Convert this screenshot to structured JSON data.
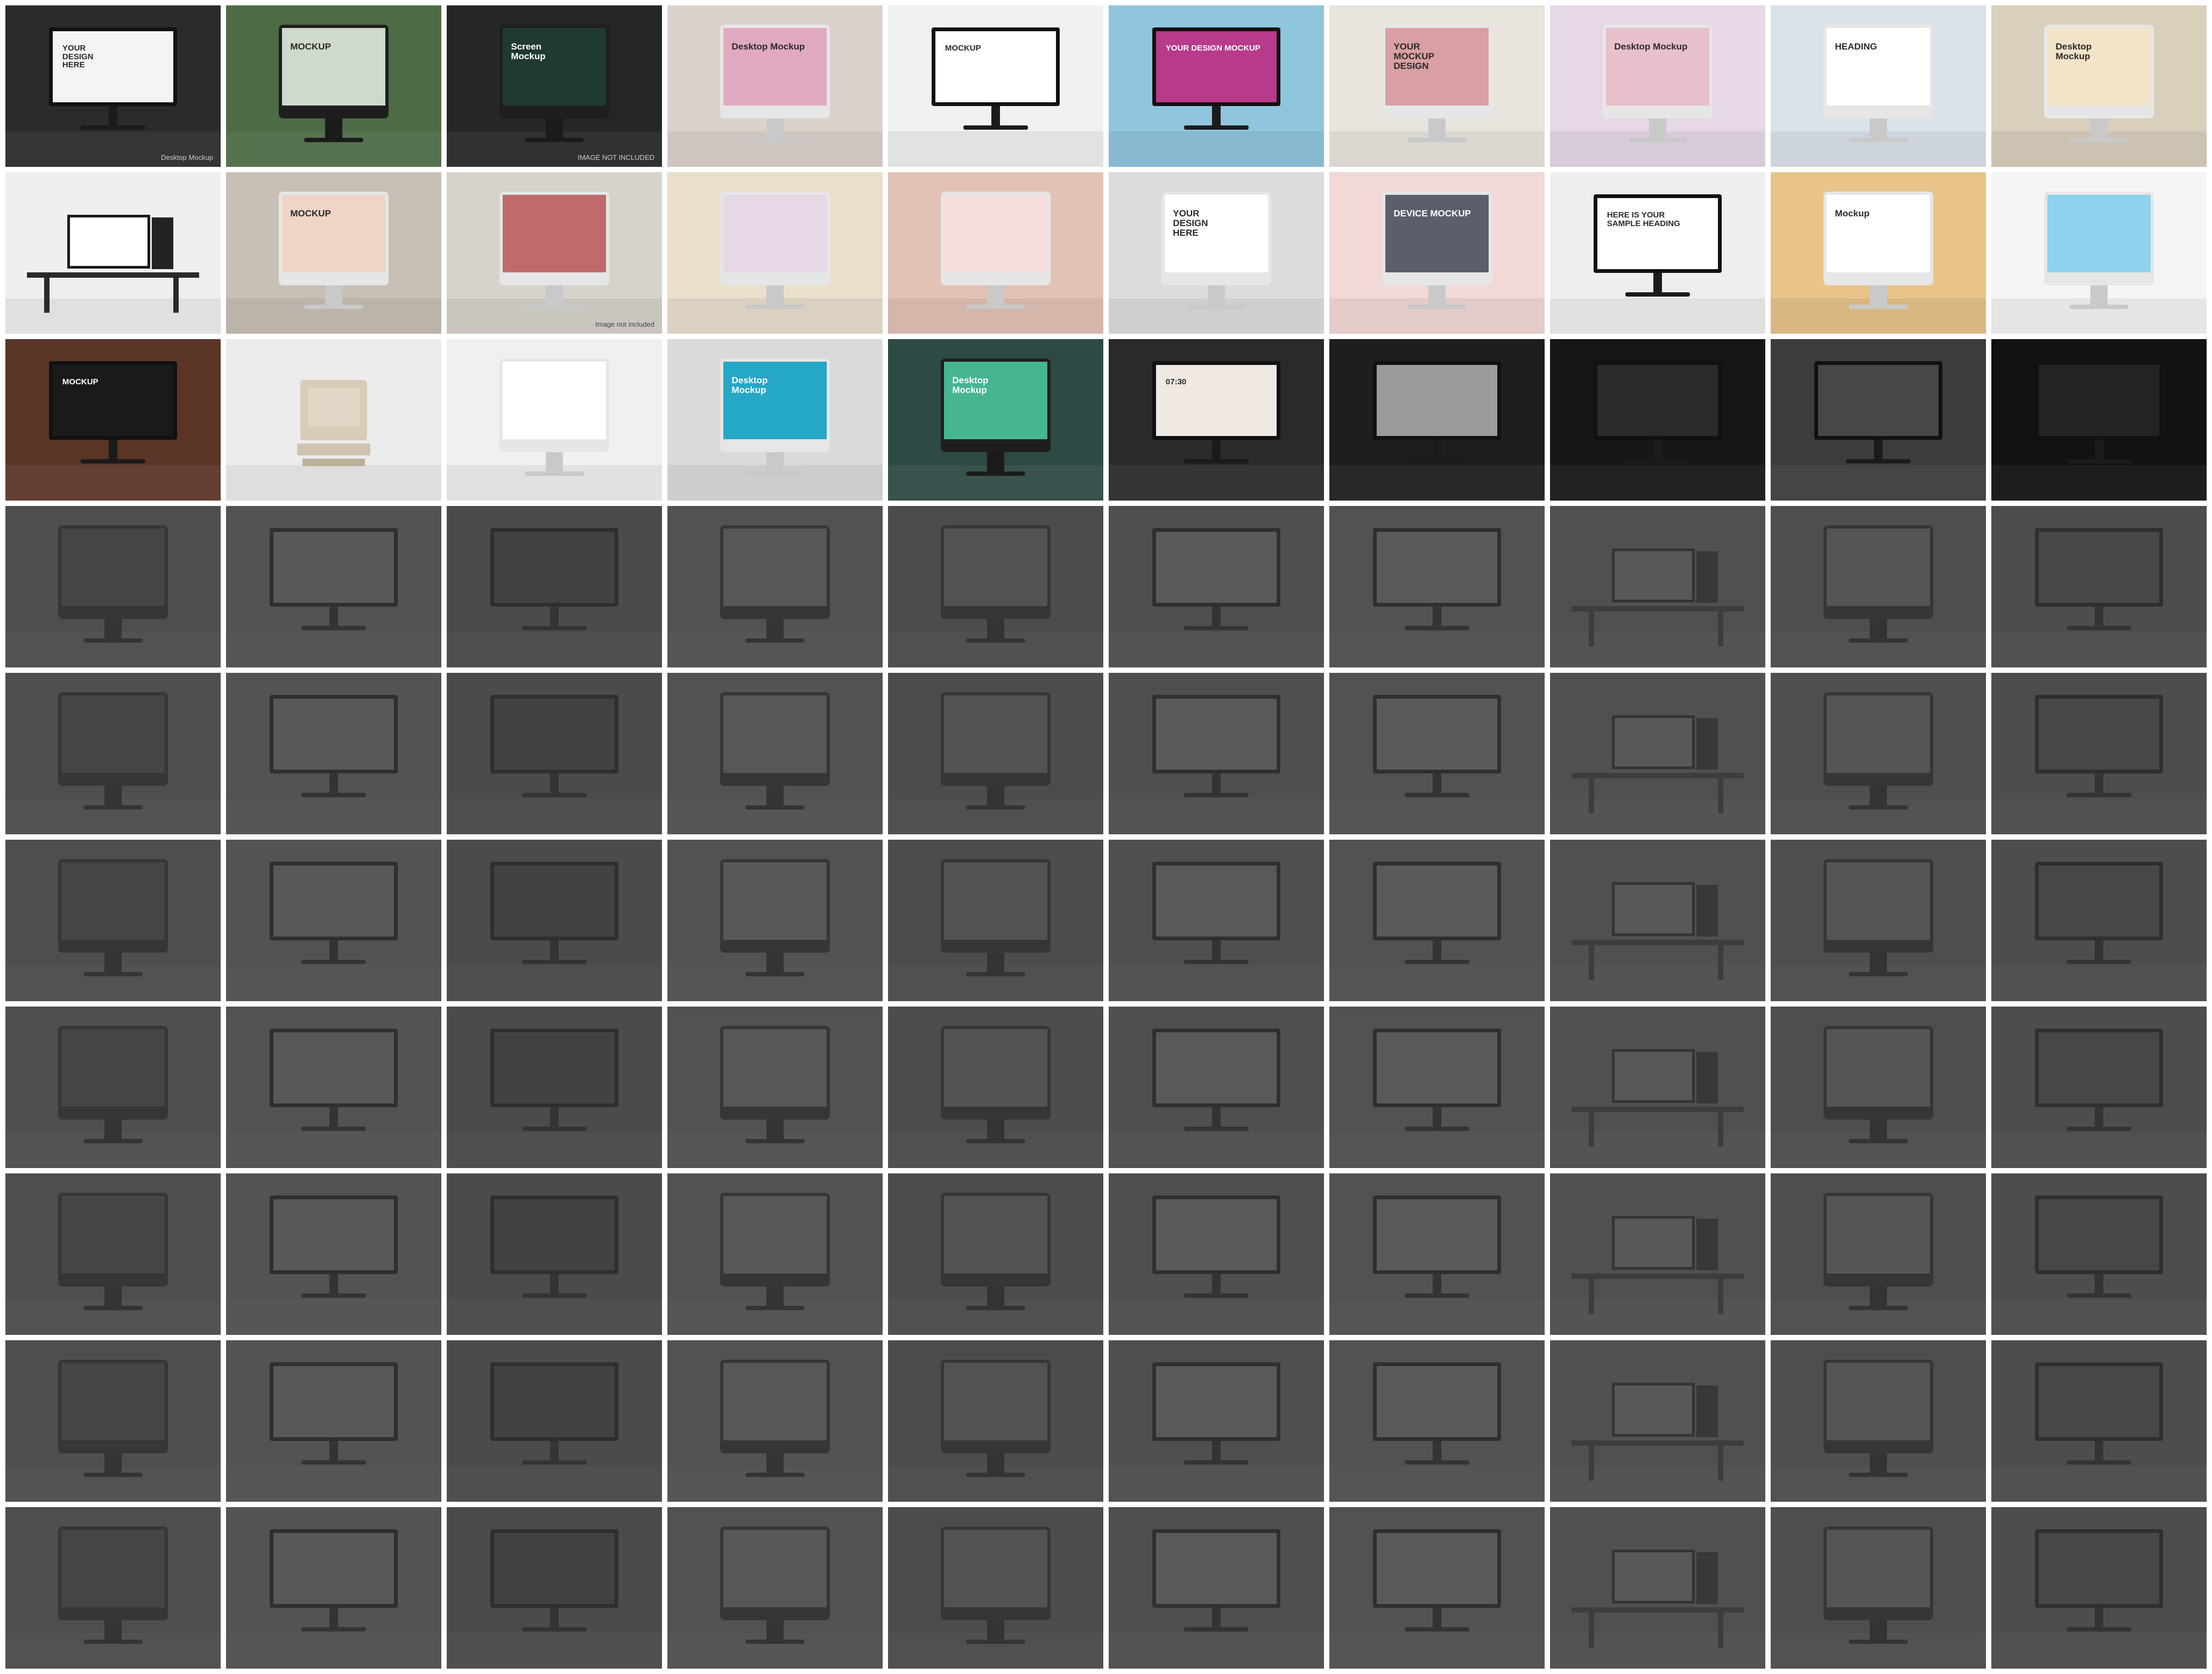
{
  "grid": {
    "cols": 10,
    "rows": 10,
    "tiles": [
      {
        "bg": "#2b2b2b",
        "screen": "#f4f4f4",
        "kind": "monitor",
        "text": "YOUR\nDESIGN\nHERE",
        "sub": "Desktop Mockup",
        "tone": "dark"
      },
      {
        "bg": "#4d6b45",
        "screen": "#cfd9cc",
        "kind": "imac",
        "text": "MOCKUP",
        "sub": "",
        "tone": "green"
      },
      {
        "bg": "#262626",
        "screen": "#1f3a2e",
        "kind": "imac",
        "text": "Screen\nMockup",
        "sub": "IMAGE NOT INCLUDED",
        "tone": "dark"
      },
      {
        "bg": "#dcd2cc",
        "screen": "#e1a9c0",
        "kind": "imac",
        "text": "Desktop Mockup",
        "sub": "",
        "tone": "light"
      },
      {
        "bg": "#f1f1f1",
        "screen": "#ffffff",
        "kind": "monitor",
        "text": "MOCKUP",
        "sub": "",
        "tone": "light"
      },
      {
        "bg": "#8fc5dd",
        "screen": "#b83a8a",
        "kind": "monitor",
        "text": "YOUR DESIGN MOCKUP",
        "sub": "",
        "tone": "blue"
      },
      {
        "bg": "#e9e4de",
        "screen": "#d9a0a4",
        "kind": "imac",
        "text": "YOUR\nMOCKUP\nDESIGN",
        "sub": "",
        "tone": "light"
      },
      {
        "bg": "#e6d8e7",
        "screen": "#e7c0cd",
        "kind": "imac",
        "text": "Desktop Mockup",
        "sub": "",
        "tone": "pink"
      },
      {
        "bg": "#dbe2ea",
        "screen": "#ffffff",
        "kind": "imac",
        "text": "HEADING",
        "sub": "",
        "tone": "light"
      },
      {
        "bg": "#d9cfbd",
        "screen": "#f3e3c8",
        "kind": "imac",
        "text": "Desktop\nMockup",
        "sub": "",
        "tone": "light"
      },
      {
        "bg": "#efefef",
        "screen": "#ffffff",
        "kind": "desk",
        "text": "",
        "sub": "",
        "tone": "light"
      },
      {
        "bg": "#c8bfb6",
        "screen": "#f0d4c8",
        "kind": "imac",
        "text": "MOCKUP",
        "sub": "",
        "tone": "light"
      },
      {
        "bg": "#d8d2cc",
        "screen": "#c06b6b",
        "kind": "imac",
        "text": "",
        "sub": "Image not included",
        "tone": "light"
      },
      {
        "bg": "#e9dfcc",
        "screen": "#e7d8e6",
        "kind": "imac",
        "text": "",
        "sub": "",
        "tone": "light"
      },
      {
        "bg": "#e2c2b5",
        "screen": "#f4dede",
        "kind": "imac",
        "text": "",
        "sub": "",
        "tone": "light"
      },
      {
        "bg": "#dcdcdc",
        "screen": "#ffffff",
        "kind": "imac",
        "text": "YOUR\nDESIGN\nHERE",
        "sub": "",
        "tone": "light"
      },
      {
        "bg": "#f2d8d6",
        "screen": "#5a5f6a",
        "kind": "imac",
        "text": "DEVICE MOCKUP",
        "sub": "",
        "tone": "pink"
      },
      {
        "bg": "#eeeeee",
        "screen": "#ffffff",
        "kind": "monitor",
        "text": "HERE IS YOUR\nSAMPLE HEADING",
        "sub": "",
        "tone": "light"
      },
      {
        "bg": "#e8c38a",
        "screen": "#ffffff",
        "kind": "imac",
        "text": "Mockup",
        "sub": "",
        "tone": "light"
      },
      {
        "bg": "#f5f5f5",
        "screen": "#8fd1ef",
        "kind": "imac",
        "text": "",
        "sub": "",
        "tone": "light"
      },
      {
        "bg": "#5a3526",
        "screen": "#1a1a1a",
        "kind": "monitor",
        "text": "MOCKUP",
        "sub": "",
        "tone": "dark"
      },
      {
        "bg": "#ececec",
        "screen": "#e4d6c6",
        "kind": "retro",
        "text": "",
        "sub": "",
        "tone": "light"
      },
      {
        "bg": "#f0f0f0",
        "screen": "#ffffff",
        "kind": "imac",
        "text": "",
        "sub": "",
        "tone": "light"
      },
      {
        "bg": "#dadada",
        "screen": "#25a7c6",
        "kind": "imac",
        "text": "Desktop\nMockup",
        "sub": "",
        "tone": "light"
      },
      {
        "bg": "#2e4a44",
        "screen": "#45b592",
        "kind": "imac",
        "text": "Desktop\nMockup",
        "sub": "",
        "tone": "green"
      },
      {
        "bg": "#2a2a2a",
        "screen": "#efe8e3",
        "kind": "monitor",
        "text": "07:30",
        "sub": "",
        "tone": "dark"
      },
      {
        "bg": "#1e1e1e",
        "screen": "#9a9a9a",
        "kind": "monitor",
        "text": "",
        "sub": "",
        "tone": "dark"
      },
      {
        "bg": "#161616",
        "screen": "#2a2a2a",
        "kind": "monitor",
        "text": "",
        "sub": "",
        "tone": "dim"
      },
      {
        "bg": "#3c3c3c",
        "screen": "#474747",
        "kind": "monitor",
        "text": "",
        "sub": "",
        "tone": "dim"
      },
      {
        "bg": "#121212",
        "screen": "#232323",
        "kind": "monitor",
        "text": "",
        "sub": "",
        "tone": "dim"
      }
    ],
    "dim_tiles": [
      {
        "bg": "#4a4a4a",
        "screen": "#3a3a3a",
        "kind": "imac"
      },
      {
        "bg": "#525252",
        "screen": "#5c5c5c",
        "kind": "monitor"
      },
      {
        "bg": "#444444",
        "screen": "#333333",
        "kind": "monitor"
      },
      {
        "bg": "#505050",
        "screen": "#5a5a5a",
        "kind": "imac"
      },
      {
        "bg": "#464646",
        "screen": "#505050",
        "kind": "imac"
      },
      {
        "bg": "#4c4c4c",
        "screen": "#5e5e5e",
        "kind": "monitor"
      },
      {
        "bg": "#515151",
        "screen": "#606060",
        "kind": "monitor"
      },
      {
        "bg": "#4e4e4e",
        "screen": "#5c5c5c",
        "kind": "desk"
      },
      {
        "bg": "#4a4a4a",
        "screen": "#565656",
        "kind": "imac"
      },
      {
        "bg": "#484848",
        "screen": "#3d3d3d",
        "kind": "monitor"
      }
    ]
  }
}
